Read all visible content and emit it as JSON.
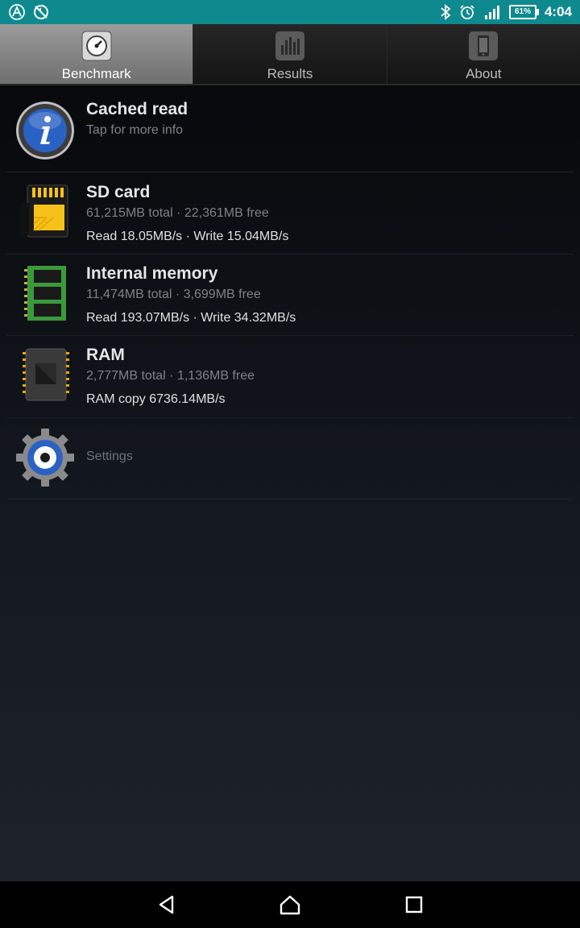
{
  "status_bar": {
    "battery": "61%",
    "time": "4:04",
    "icons": [
      "a-logo-icon",
      "no-sync-icon",
      "bluetooth-icon",
      "alarm-icon",
      "signal-icon",
      "battery-icon"
    ]
  },
  "tabs": [
    {
      "label": "Benchmark",
      "icon": "speedometer-icon",
      "active": true
    },
    {
      "label": "Results",
      "icon": "bar-chart-icon",
      "active": false
    },
    {
      "label": "About",
      "icon": "phone-icon",
      "active": false
    }
  ],
  "items": {
    "cached_read": {
      "title": "Cached read",
      "subtitle": "Tap for more info",
      "icon": "info-icon"
    },
    "sd_card": {
      "title": "SD card",
      "subtitle": "61,215MB total · 22,361MB free",
      "detail": "Read 18.05MB/s · Write 15.04MB/s",
      "icon": "sd-card-icon"
    },
    "internal_memory": {
      "title": "Internal memory",
      "subtitle": "11,474MB total · 3,699MB free",
      "detail": "Read 193.07MB/s · Write 34.32MB/s",
      "icon": "memory-chip-icon"
    },
    "ram": {
      "title": "RAM",
      "subtitle": "2,777MB total · 1,136MB free",
      "detail": "RAM copy 6736.14MB/s",
      "icon": "ram-chip-icon"
    },
    "settings": {
      "title": "Settings",
      "icon": "gear-icon"
    }
  },
  "navigation": {
    "icons": [
      "back-icon",
      "home-icon",
      "recents-icon"
    ]
  },
  "colors": {
    "status_bar": "#0e8a8f",
    "active_tab": "#8a8a8a",
    "sd_yellow": "#f6c21a",
    "memory_green": "#3a9a3a",
    "info_blue": "#2a62c4"
  }
}
